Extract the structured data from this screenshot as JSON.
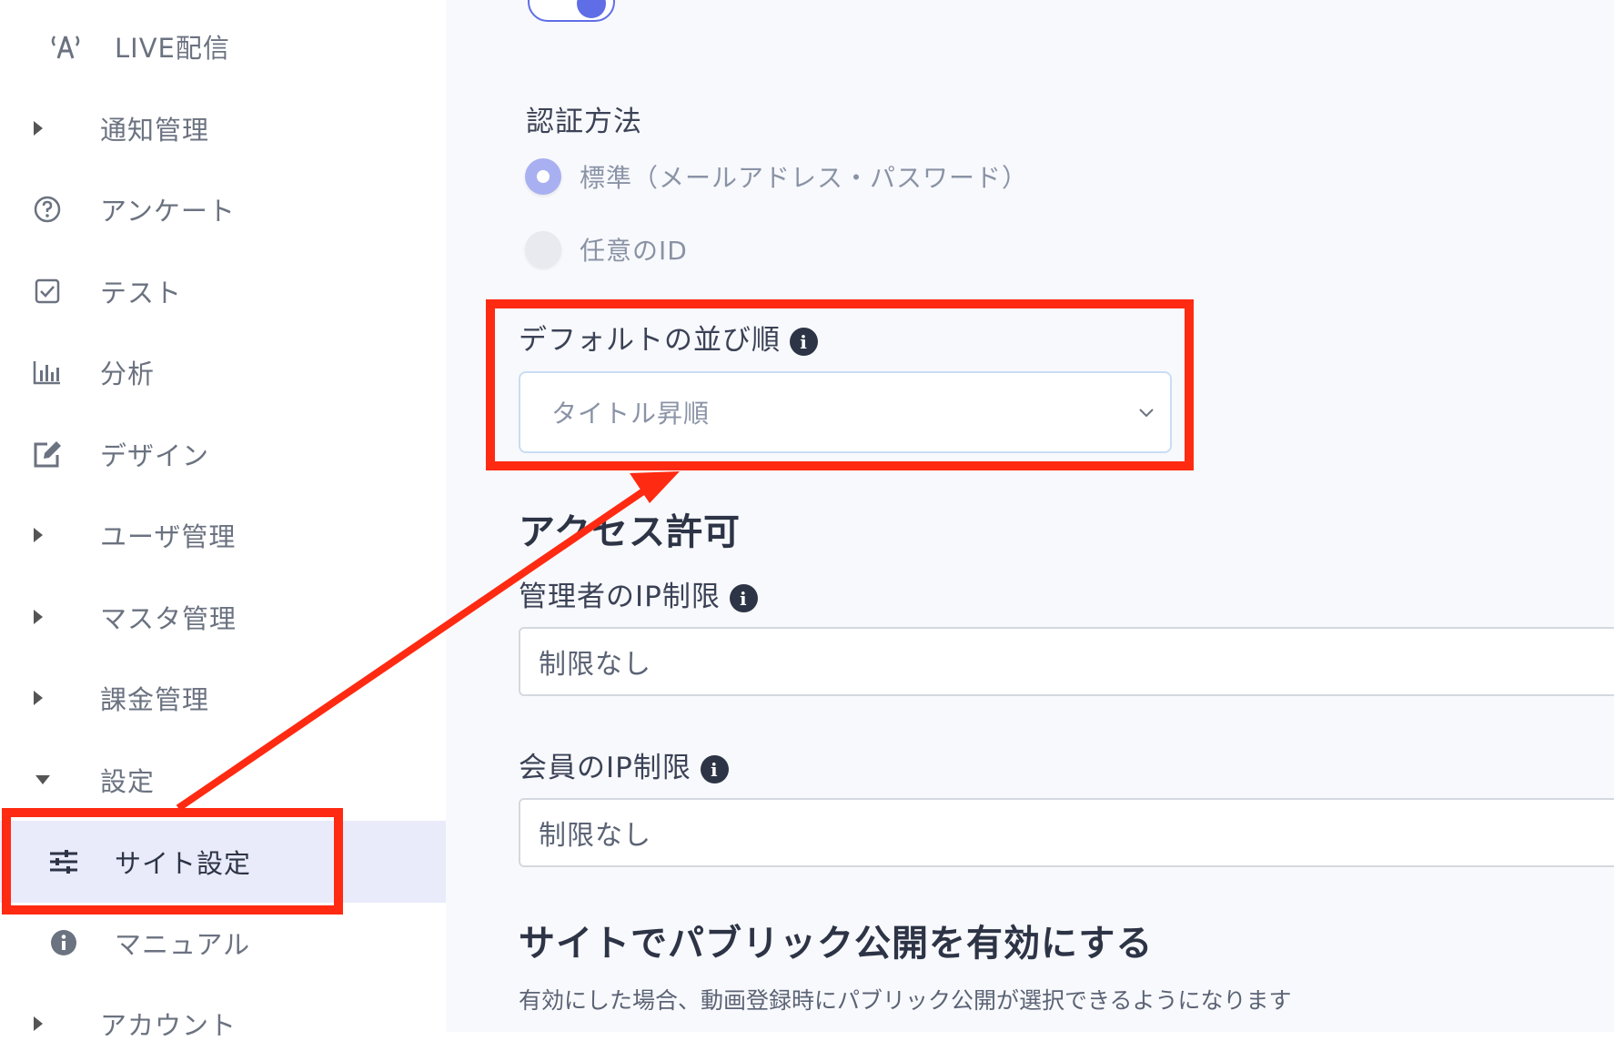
{
  "sidebar": {
    "items": [
      {
        "label": "LIVE配信",
        "icon": "broadcast-icon"
      },
      {
        "label": "通知管理",
        "icon": "caret-right-icon"
      },
      {
        "label": "アンケート",
        "icon": "question-circle-icon"
      },
      {
        "label": "テスト",
        "icon": "check-square-icon"
      },
      {
        "label": "分析",
        "icon": "bar-chart-icon"
      },
      {
        "label": "デザイン",
        "icon": "edit-icon"
      },
      {
        "label": "ユーザ管理",
        "icon": "caret-right-icon"
      },
      {
        "label": "マスタ管理",
        "icon": "caret-right-icon"
      },
      {
        "label": "課金管理",
        "icon": "caret-right-icon"
      },
      {
        "label": "設定",
        "icon": "caret-down-icon"
      },
      {
        "label": "サイト設定",
        "icon": "sliders-icon",
        "active": true
      },
      {
        "label": "マニュアル",
        "icon": "info-circle-icon"
      },
      {
        "label": "アカウント",
        "icon": "caret-right-icon"
      }
    ]
  },
  "main": {
    "auth": {
      "label": "認証方法",
      "options": [
        {
          "label": "標準（メールアドレス・パスワード）",
          "checked": true
        },
        {
          "label": "任意のID",
          "checked": false
        }
      ]
    },
    "sort": {
      "label": "デフォルトの並び順",
      "selected": "タイトル昇順"
    },
    "access": {
      "heading": "アクセス許可",
      "admin_ip": {
        "label": "管理者のIP制限",
        "value": "制限なし"
      },
      "member_ip": {
        "label": "会員のIP制限",
        "value": "制限なし"
      }
    },
    "public": {
      "heading": "サイトでパブリック公開を有効にする",
      "description": "有効にした場合、動画登録時にパブリック公開が選択できるようになります"
    }
  },
  "colors": {
    "accent": "#5f6ee6",
    "highlight": "#ff2a12",
    "active_bg": "#e9ebfa"
  }
}
